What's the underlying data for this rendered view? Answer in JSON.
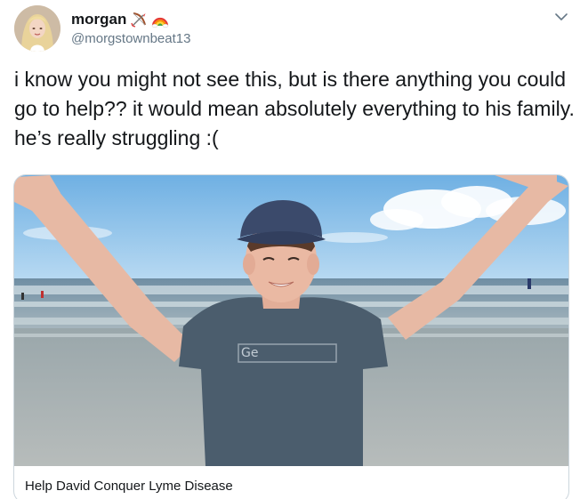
{
  "user": {
    "display_name": "morgan",
    "handle": "@morgstownbeat13",
    "emoji_1": "bow-and-arrow-emoji",
    "emoji_2": "rainbow-emoji"
  },
  "tweet": {
    "text": "i know you might not see this, but is there anything you could go to help?? it would mean absolutely everything to his family. he’s really struggling :("
  },
  "card": {
    "title": "Help David Conquer Lyme Disease",
    "shirt_text": "Ge"
  },
  "icons": {
    "menu": "chevron-down-icon"
  },
  "colors": {
    "text": "#14171a",
    "secondary": "#657786",
    "border": "#ccd6dd"
  }
}
